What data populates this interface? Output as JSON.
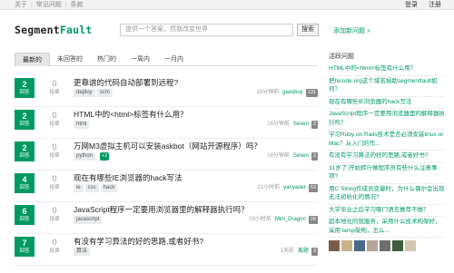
{
  "topbar": {
    "left": [
      "关于",
      "常见问题",
      "条款"
    ],
    "right": [
      "登录",
      "注册"
    ]
  },
  "header": {
    "logo_main": "Segment",
    "logo_accent": "Fault",
    "search_placeholder": "提供一个答案，然我改变世界",
    "search_button": "搜索",
    "add_question": "添加新问题 »"
  },
  "tabs": [
    "最新的",
    "未回答的",
    "热门的",
    "一周内",
    "一月内"
  ],
  "questions": [
    {
      "answers": "2",
      "answers_label": "回答",
      "votes": "0",
      "votes_label": "投票",
      "title": "更靠谱的代码自动部署到远程?",
      "tags": [
        "deploy",
        "scm"
      ],
      "badge": "",
      "time": "10分钟前",
      "user": "gaosboy",
      "score": "131"
    },
    {
      "answers": "2",
      "answers_label": "回答",
      "votes": "0",
      "votes_label": "投票",
      "title": "HTML中的<html>标签有什么用？",
      "tags": [
        "html"
      ],
      "badge": "",
      "time": "16分钟前",
      "user": "Seven",
      "score": "2"
    },
    {
      "answers": "2",
      "answers_label": "回答",
      "votes": "0",
      "votes_label": "投票",
      "title": "万网M3虚拟主机可以安装askbot（网站开源程序）吗？",
      "tags": [
        "python"
      ],
      "badge": "+2",
      "time": "16分钟前",
      "user": "Seven",
      "score": "2"
    },
    {
      "answers": "4",
      "answers_label": "回答",
      "votes": "0",
      "votes_label": "投票",
      "title": "现在有哪些IE浏览器的hack写法",
      "tags": [
        "ie",
        "css",
        "hack"
      ],
      "badge": "",
      "time": "21小时前",
      "user": "yanyaoer",
      "score": "53"
    },
    {
      "answers": "6",
      "answers_label": "回答",
      "votes": "0",
      "votes_label": "投票",
      "title": "JavaScript程序一定要用浏览器里的解释器执行吗？",
      "tags": [
        "javascript"
      ],
      "badge": "",
      "time": "23小时前",
      "user": "Mini_Dragon",
      "score": "28"
    },
    {
      "answers": "7",
      "answers_label": "回答",
      "votes": "0",
      "votes_label": "投票",
      "title": "有没有学习算法的好的思路,或者好书?",
      "tags": [
        "算法"
      ],
      "badge": "",
      "time": "1天前",
      "user": "离题",
      "score": "3"
    }
  ],
  "sidebar": {
    "heading": "活跃问题",
    "items": [
      "HTML中的<html>标签有什么用？",
      "把hicode.org这个域名捐助segmentfault如何？",
      "现在有哪些IE浏览器的hack写法",
      "JavaScript程序一定要用浏览器里的解释器执行吗？",
      "学习Ruby on Rails技术是否必须安装linux or Mac？从入门的作...",
      "有没有学习算法的好的思路,或者好书?",
      "31岁了,开始转行做程序员有些什么注意事项?",
      "用C String作成员变量时，为什么偶尔会出现无法初始化的情况?",
      "大学毕业之后学习哪门语言推荐不推？",
      "超本地化的就服务，采用什么技术构架好，采用 lamp架构，怎么..."
    ]
  },
  "colors": {
    "accent": "#009a61"
  }
}
